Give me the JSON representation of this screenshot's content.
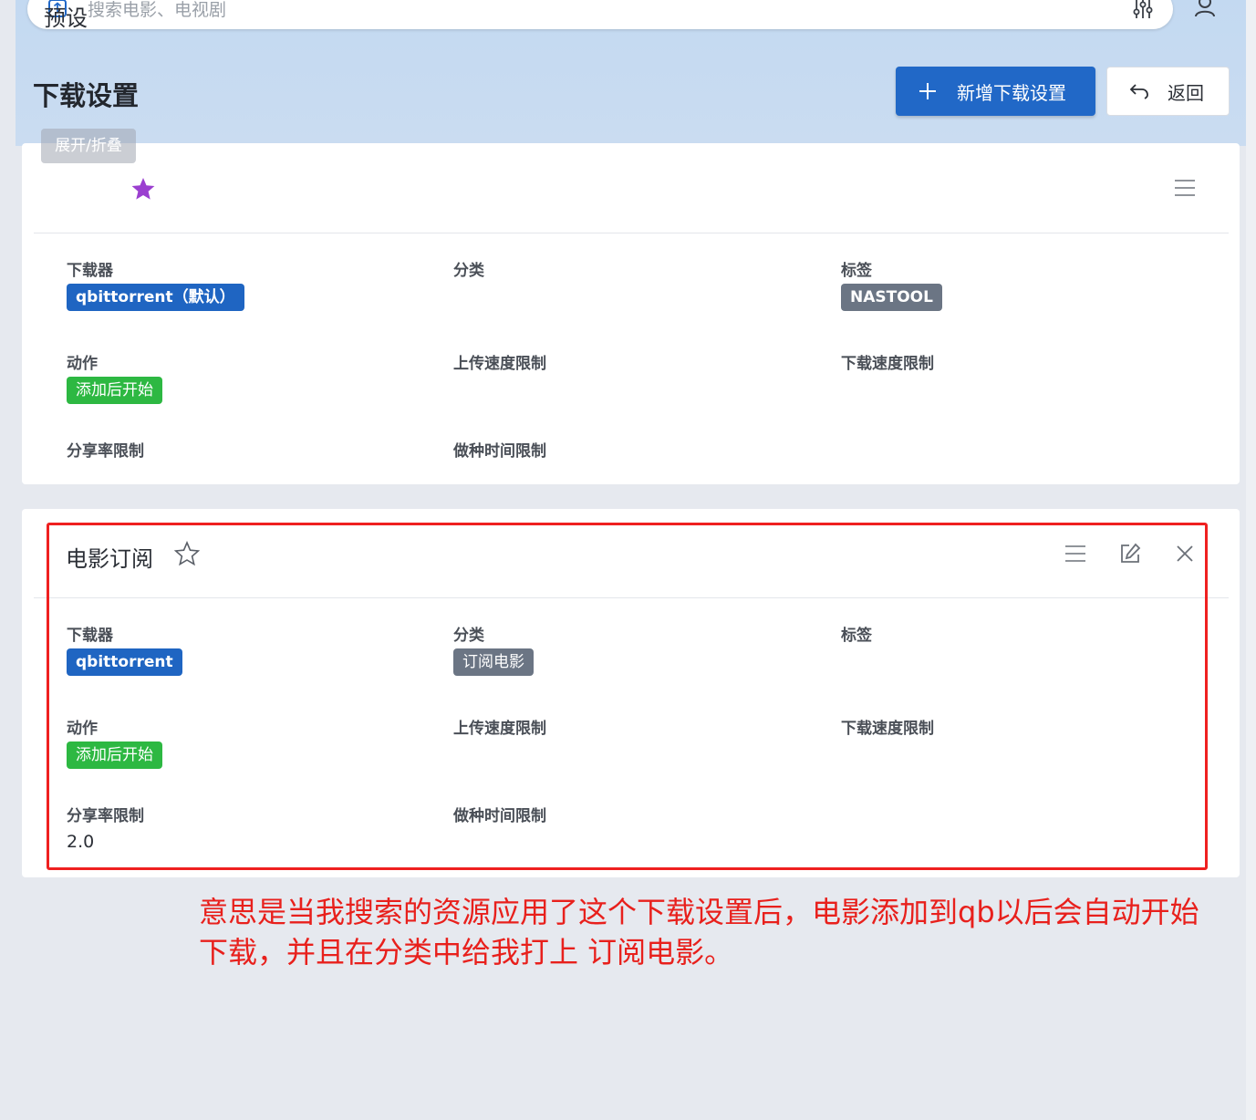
{
  "search": {
    "placeholder": "搜索电影、电视剧"
  },
  "header": {
    "title": "下载设置",
    "add_button": "新增下载设置",
    "back_button": "返回"
  },
  "tooltip": "展开/折叠",
  "cards": [
    {
      "title": "预设",
      "starred": true,
      "star_color": "#9b3fd0",
      "fields": {
        "downloader_label": "下载器",
        "downloader_value": "qbittorrent（默认）",
        "category_label": "分类",
        "tag_label": "标签",
        "tag_value": "NASTOOL",
        "action_label": "动作",
        "action_value": "添加后开始",
        "upload_label": "上传速度限制",
        "download_label": "下载速度限制",
        "ratio_label": "分享率限制",
        "seed_time_label": "做种时间限制"
      }
    },
    {
      "title": "电影订阅",
      "starred": false,
      "fields": {
        "downloader_label": "下载器",
        "downloader_value": "qbittorrent",
        "category_label": "分类",
        "category_value": "订阅电影",
        "tag_label": "标签",
        "action_label": "动作",
        "action_value": "添加后开始",
        "upload_label": "上传速度限制",
        "download_label": "下载速度限制",
        "ratio_label": "分享率限制",
        "ratio_value": "2.0",
        "seed_time_label": "做种时间限制"
      }
    }
  ],
  "annotation": {
    "line1": "意思是当我搜索的资源应用了这个下载设置后，电影添加到qb以后会自动开始",
    "line2": "下载，并且在分类中给我打上 订阅电影。"
  },
  "colors": {
    "primary": "#2168c7",
    "chip_slate": "#6b7584",
    "chip_green": "#2db842",
    "annotation_red": "#e8201c"
  }
}
